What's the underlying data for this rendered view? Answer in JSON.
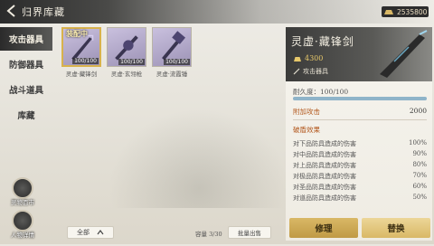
{
  "header": {
    "title": "归界库藏",
    "currency": "2535800"
  },
  "sidebar": {
    "tabs": [
      "攻击器具",
      "防御器具",
      "战斗道具",
      "库藏"
    ],
    "active": 0
  },
  "shortcuts": {
    "left_top": "灵物百市",
    "left_bottom": "人物详情"
  },
  "inventory": {
    "items": [
      {
        "name": "灵虚·藏锋剑",
        "count": "100/100",
        "tag": "装配中",
        "selected": true
      },
      {
        "name": "灵虚·玄翎枪",
        "count": "100/100",
        "tag": "",
        "selected": false
      },
      {
        "name": "灵虚·流霞锤",
        "count": "100/100",
        "tag": "",
        "selected": false
      }
    ],
    "filter_label": "全部",
    "capacity": "容量 3/30",
    "batch_label": "批量出售"
  },
  "detail": {
    "title": "灵虚·藏锋剑",
    "price": "4300",
    "subtitle": "攻击器具",
    "durability_label": "耐久度：100/100",
    "durability_value": 1.0,
    "attack_label": "附加攻击",
    "attack_value": "2000",
    "pen_title": "破盾效果",
    "pen_rows": [
      {
        "label": "对下品防具造成的伤害",
        "value": "100%"
      },
      {
        "label": "对中品防具造成的伤害",
        "value": "90%"
      },
      {
        "label": "对上品防具造成的伤害",
        "value": "80%"
      },
      {
        "label": "对极品防具造成的伤害",
        "value": "70%"
      },
      {
        "label": "对圣品防具造成的伤害",
        "value": "60%"
      },
      {
        "label": "对道品防具造成的伤害",
        "value": "50%"
      }
    ]
  },
  "actions": {
    "repair": "修理",
    "replace": "替换"
  },
  "colors": {
    "accent": "#b2561b",
    "gold": "#d9b866",
    "dark": "#2b2b2b"
  }
}
